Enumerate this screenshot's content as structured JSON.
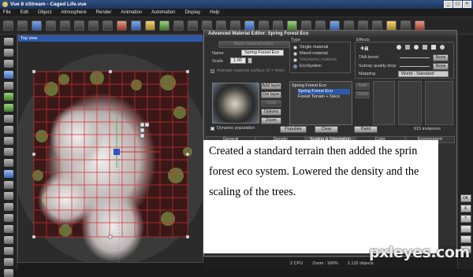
{
  "window": {
    "title": "Vue 8 xStream - Caged Life.vue",
    "buttons": [
      "_",
      "□",
      "×"
    ]
  },
  "menu": [
    "File",
    "Edit",
    "Object",
    "Atmosphere",
    "Render",
    "Animation",
    "Automation",
    "Display",
    "Help"
  ],
  "viewport": {
    "label": "Top view"
  },
  "editor": {
    "title": "Advanced Material Editor: Spring Forest Eco",
    "basic_btn": "Basic material editor",
    "name_label": "Name",
    "name_value": "Spring Forest Eco",
    "scale_label": "Scale",
    "scale_value": "1.00",
    "animate_label": "Animate material surface (Z = time)",
    "type_group": "Type",
    "type_options": [
      {
        "label": "Single material",
        "selected": false,
        "enabled": true
      },
      {
        "label": "Mixed material",
        "selected": false,
        "enabled": true
      },
      {
        "label": "Volumetric material",
        "selected": false,
        "enabled": false
      },
      {
        "label": "EcoSystem",
        "selected": true,
        "enabled": true
      }
    ],
    "tree": [
      "Spring Forest Eco",
      "Spring Forest Eco",
      "Forest Terrain + Deco"
    ],
    "effects": {
      "group": "Effects",
      "taa_label": "TAA boost",
      "taa_value": "None",
      "subray_label": "Subray quality drop",
      "subray_value": "None",
      "mapping_label": "Mapping",
      "mapping_value": "World - Standard"
    },
    "layer_buttons": [
      "Add layer",
      "Del layer",
      "Tools",
      "Options",
      "Zoom"
    ],
    "side_buttons": [
      "Edit",
      "Clear"
    ],
    "dynamic_label": "Dynamic population",
    "populate": "Populate",
    "clear": "Clear",
    "paint": "Paint",
    "instances": "615 instances",
    "tabs": [
      "General",
      "Density",
      "Scaling & Orientation",
      "Color",
      "Environment"
    ],
    "active_tab": "Scaling & Orientation"
  },
  "right_buttons": [
    "OK",
    "X",
    "?"
  ],
  "status": {
    "cpu": "2 CPU",
    "zoom": "Zoom : 160%",
    "objects": "2,132 objects"
  },
  "caption": "Created a standard terrain then added the sprin forest eco system. Lowered the density and the scaling of the trees.",
  "watermark": "pxleyes.com",
  "colors": {
    "viewport_red_grid": "#d03030",
    "editor_bg": "#2f2f2f",
    "caption_bg": "#ffffff",
    "titlebar": "#2e4e80"
  }
}
